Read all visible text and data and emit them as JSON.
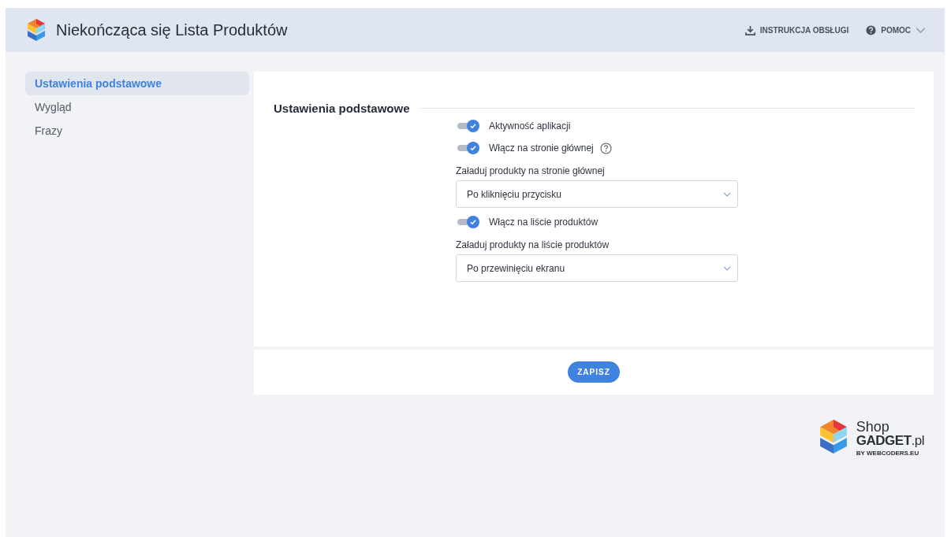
{
  "header": {
    "title": "Niekończąca się Lista Produktów",
    "links": [
      {
        "kind": "download",
        "label": "INSTRUKCJA OBSŁUGI"
      },
      {
        "kind": "help",
        "label": "POMOC"
      }
    ]
  },
  "sidebar": {
    "items": [
      {
        "label": "Ustawienia podstawowe",
        "selected": true
      },
      {
        "label": "Wygląd",
        "selected": false
      },
      {
        "label": "Frazy",
        "selected": false
      }
    ]
  },
  "section": {
    "title": "Ustawienia podstawowe",
    "fields": [
      {
        "kind": "toggle",
        "label": "Aktywność aplikacji",
        "on": true,
        "help": false
      },
      {
        "kind": "toggle",
        "label": "Włącz na stronie głównej",
        "on": true,
        "help": true
      },
      {
        "kind": "select",
        "label": "Załaduj produkty na stronie głównej",
        "value": "Po kliknięciu przycisku"
      },
      {
        "kind": "toggle",
        "label": "Włącz na liście produktów",
        "on": true,
        "help": false
      },
      {
        "kind": "select",
        "label": "Załaduj produkty na liście produktów",
        "value": "Po przewinięciu ekranu"
      }
    ]
  },
  "save_button": "ZAPISZ",
  "brand": {
    "line1": "Shop",
    "line2": "**GADGET**.pl",
    "byline": "BY WEBCODERS.EU"
  }
}
